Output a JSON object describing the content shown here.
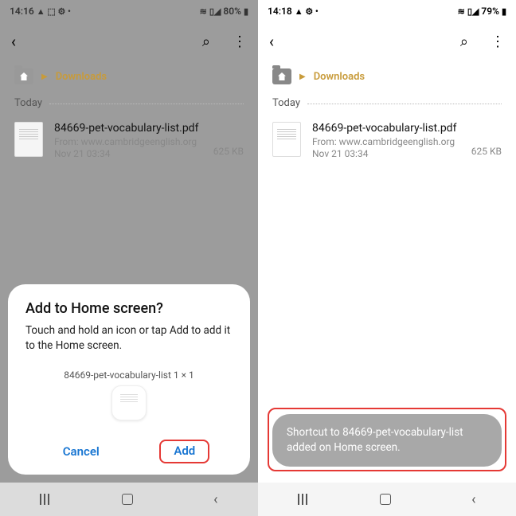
{
  "left": {
    "status": {
      "time": "14:16",
      "icons": "▲ ⬚ ⚙ •",
      "signal": "📶",
      "wifi": "≋",
      "battery": "80%",
      "batt_icon": "▮"
    },
    "breadcrumb": {
      "label": "Downloads"
    },
    "date_header": "Today",
    "file": {
      "name": "84669-pet-vocabulary-list.pdf",
      "from": "From: www.cambridgeenglish.org",
      "date": "Nov 21 03:34",
      "size": "625 KB"
    },
    "dialog": {
      "title": "Add to Home screen?",
      "text": "Touch and hold an icon or tap Add to add it to the Home screen.",
      "preview_label": "84669-pet-vocabulary-list  1 × 1",
      "cancel": "Cancel",
      "add": "Add"
    }
  },
  "right": {
    "status": {
      "time": "14:18",
      "icons": "▲ ⚙ •",
      "signal": "📶",
      "wifi": "≋",
      "battery": "79%",
      "batt_icon": "▮"
    },
    "breadcrumb": {
      "label": "Downloads"
    },
    "date_header": "Today",
    "file": {
      "name": "84669-pet-vocabulary-list.pdf",
      "from": "From: www.cambridgeenglish.org",
      "date": "Nov 21 03:34",
      "size": "625 KB"
    },
    "toast": "Shortcut to 84669-pet-vocabulary-list added on Home screen."
  }
}
